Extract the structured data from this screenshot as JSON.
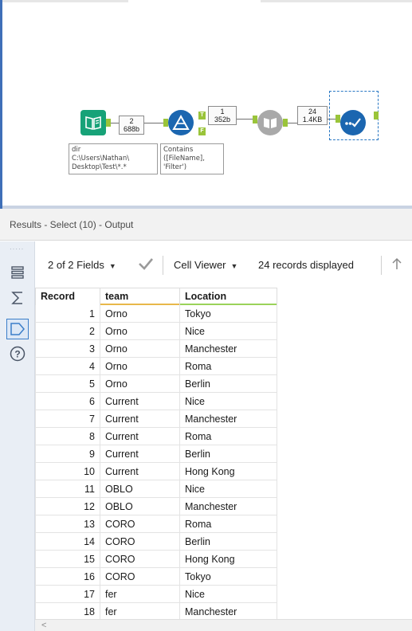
{
  "canvas": {
    "tools": {
      "input": {
        "count": "2",
        "size": "688b"
      },
      "filter": {
        "count": "1",
        "size": "352b",
        "true_anchor": "T",
        "false_anchor": "F"
      },
      "dynamic_input": {
        "count": "24",
        "size": "1.4KB"
      }
    },
    "annotations": {
      "input": [
        "dir",
        "C:\\Users\\Nathan\\",
        "Desktop\\Test\\*.*"
      ],
      "filter": [
        "Contains",
        "([FileName],",
        "'Filter')"
      ]
    },
    "colors": {
      "input_tool": "#17a278",
      "filter_tool": "#1b66b0",
      "select_tool": "#1b66b0",
      "anchor": "#9ac43a"
    }
  },
  "results": {
    "title": "Results - Select (10) - Output",
    "toolbar": {
      "fields_label": "2 of 2 Fields",
      "cell_viewer_label": "Cell Viewer",
      "records_label": "24 records displayed"
    },
    "rail_icons": [
      "rows-icon",
      "sum-icon",
      "tag-icon",
      "help-icon"
    ],
    "columns": [
      "Record",
      "team",
      "Location"
    ],
    "header_underline_colors": [
      "#ffffff",
      "#e8b84a",
      "#9ad35a"
    ],
    "rows": [
      [
        "1",
        "Orno",
        "Tokyo"
      ],
      [
        "2",
        "Orno",
        "Nice"
      ],
      [
        "3",
        "Orno",
        "Manchester"
      ],
      [
        "4",
        "Orno",
        "Roma"
      ],
      [
        "5",
        "Orno",
        "Berlin"
      ],
      [
        "6",
        "Current",
        "Nice"
      ],
      [
        "7",
        "Current",
        "Manchester"
      ],
      [
        "8",
        "Current",
        "Roma"
      ],
      [
        "9",
        "Current",
        "Berlin"
      ],
      [
        "10",
        "Current",
        "Hong Kong"
      ],
      [
        "11",
        "OBLO",
        "Nice"
      ],
      [
        "12",
        "OBLO",
        "Manchester"
      ],
      [
        "13",
        "CORO",
        "Roma"
      ],
      [
        "14",
        "CORO",
        "Berlin"
      ],
      [
        "15",
        "CORO",
        "Hong Kong"
      ],
      [
        "16",
        "CORO",
        "Tokyo"
      ],
      [
        "17",
        "fer",
        "Nice"
      ],
      [
        "18",
        "fer",
        "Manchester"
      ]
    ]
  }
}
